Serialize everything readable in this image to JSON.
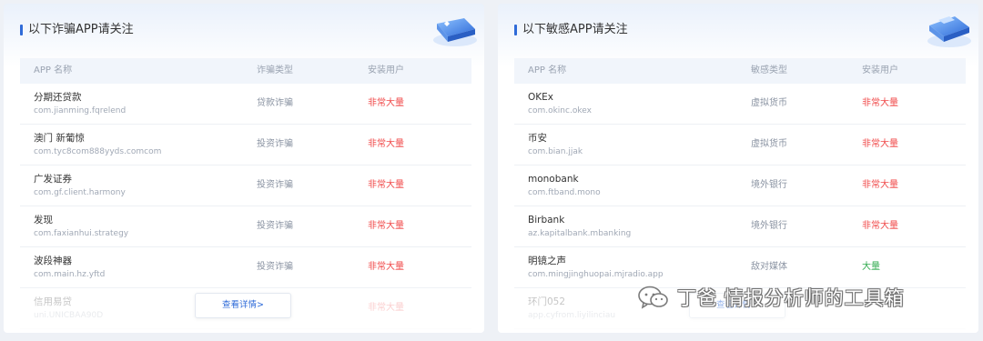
{
  "left_panel": {
    "title": "以下诈骗APP请关注",
    "headers": {
      "name": "APP 名称",
      "type": "诈骗类型",
      "users": "安装用户"
    },
    "rows": [
      {
        "name": "分期还贷款",
        "package": "com.jianming.fqrelend",
        "type": "贷款诈骗",
        "users": "非常大量",
        "users_color": "red"
      },
      {
        "name": "澳门 新葡惊",
        "package": "com.tyc8com888yyds.comcom",
        "type": "投资诈骗",
        "users": "非常大量",
        "users_color": "red"
      },
      {
        "name": "广发证券",
        "package": "com.gf.client.harmony",
        "type": "投资诈骗",
        "users": "非常大量",
        "users_color": "red"
      },
      {
        "name": "发现",
        "package": "com.faxianhui.strategy",
        "type": "投资诈骗",
        "users": "非常大量",
        "users_color": "red"
      },
      {
        "name": "波段神器",
        "package": "com.main.hz.yftd",
        "type": "投资诈骗",
        "users": "非常大量",
        "users_color": "red"
      },
      {
        "name": "信用易贷",
        "package": "uni.UNICBAA90D",
        "type": "",
        "users": "非常大量",
        "users_color": "red"
      }
    ],
    "more_button": "查看详情>"
  },
  "right_panel": {
    "title": "以下敏感APP请关注",
    "headers": {
      "name": "APP 名称",
      "type": "敏感类型",
      "users": "安装用户"
    },
    "rows": [
      {
        "name": "OKEx",
        "package": "com.okinc.okex",
        "type": "虚拟货币",
        "users": "非常大量",
        "users_color": "red"
      },
      {
        "name": "币安",
        "package": "com.bian.jjak",
        "type": "虚拟货币",
        "users": "非常大量",
        "users_color": "red"
      },
      {
        "name": "monobank",
        "package": "com.ftband.mono",
        "type": "境外银行",
        "users": "非常大量",
        "users_color": "red"
      },
      {
        "name": "Birbank",
        "package": "az.kapitalbank.mbanking",
        "type": "境外银行",
        "users": "非常大量",
        "users_color": "red"
      },
      {
        "name": "明镜之声",
        "package": "com.mingjinghuopai.mjradio.app",
        "type": "敌对媒体",
        "users": "大量",
        "users_color": "green"
      },
      {
        "name": "环门052",
        "package": "app.cyfrom.liyilinciau",
        "type": "",
        "users": "",
        "users_color": "green"
      }
    ],
    "more_button": "查看详情>"
  },
  "watermark": {
    "text": "丁爸 情报分析师的工具箱",
    "icon": "wechat-icon"
  },
  "colors": {
    "accent": "#2f6bd8",
    "danger": "#f04848",
    "ok": "#2faa4d"
  }
}
